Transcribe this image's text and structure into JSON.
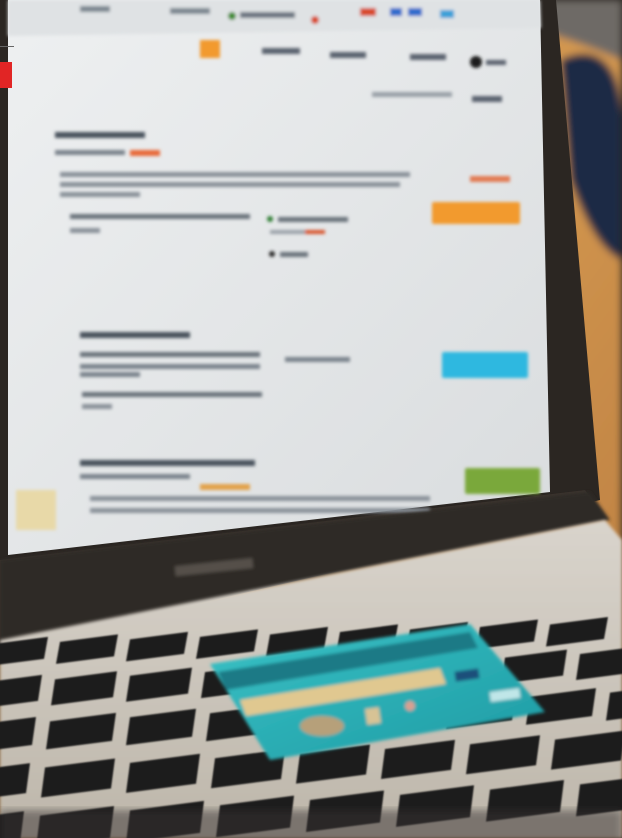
{
  "scene": {
    "description_type": "photo",
    "colors": {
      "background_wall": "#c98d4a",
      "laptop_body": "#b9b2a6",
      "bezel": "#2b2622",
      "screen": "#e6e8ea",
      "keyboard_deck": "#cfcac2",
      "key": "#1e1d1d",
      "card": "#2bb3b8",
      "orange_button": "#f29a2e",
      "blue_button": "#2fb8e0",
      "green_button": "#7aa83a",
      "red_tab": "#e12525",
      "table_surface": "#d4c9b6"
    }
  }
}
